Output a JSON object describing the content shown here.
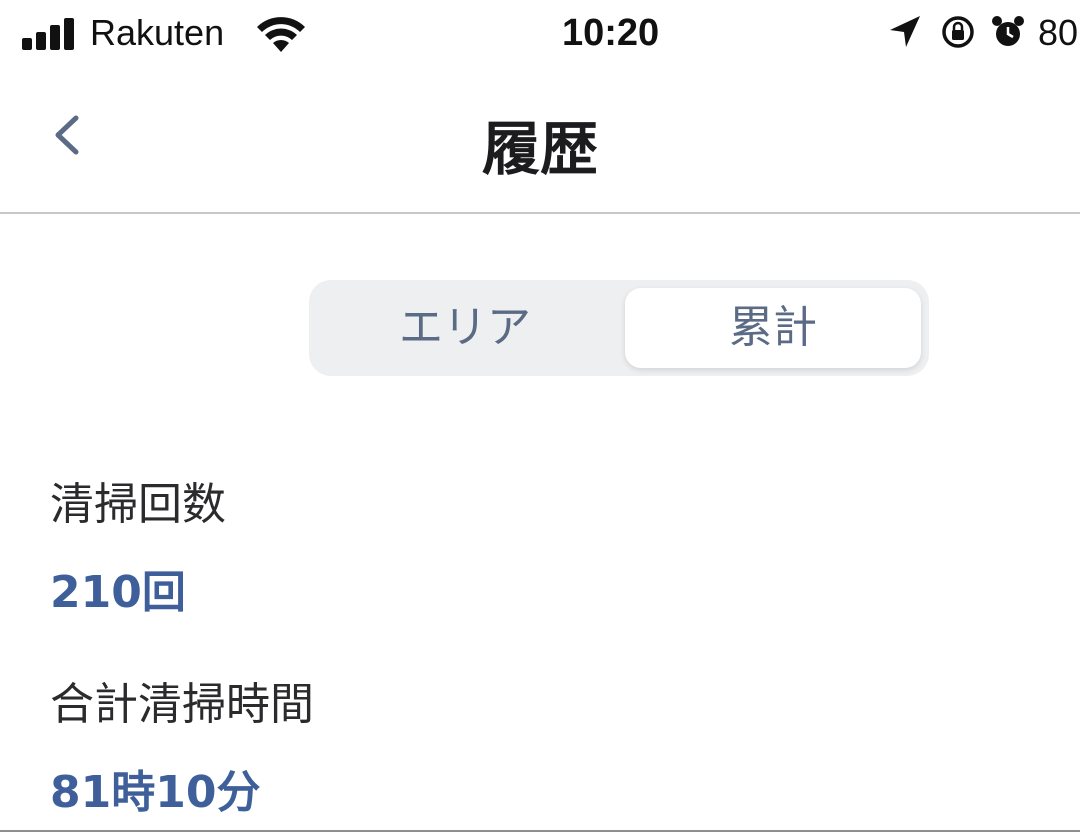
{
  "status_bar": {
    "carrier": "Rakuten",
    "time": "10:20",
    "battery": "80",
    "icons": [
      "signal-icon",
      "wifi-icon",
      "location-arrow-icon",
      "rotation-lock-icon",
      "alarm-icon"
    ]
  },
  "nav": {
    "title": "履歴",
    "back_icon": "chevron-left-icon"
  },
  "segmented": {
    "options": [
      "エリア",
      "累計"
    ],
    "selected": "累計"
  },
  "stats": {
    "count_label": "清掃回数",
    "count_value": "210回",
    "time_label": "合計清掃時間",
    "time_value": "81時10分"
  },
  "colors": {
    "accent": "#3f5f9b",
    "segment_text": "#5b6b86",
    "segment_bg": "#eeeff1"
  }
}
